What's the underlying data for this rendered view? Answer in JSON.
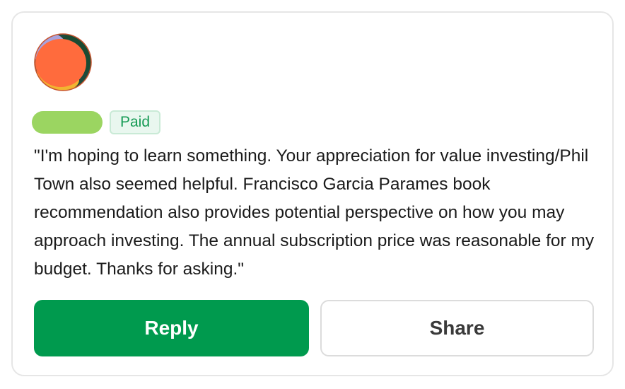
{
  "comment": {
    "badge": "Paid",
    "text": "\"I'm hoping to learn something. Your appreciation for value investing/Phil Town also seemed helpful. Francisco Garcia Parames book recommendation also provides potential perspective on how you may approach investing. The annual subscription price was reasonable for my budget. Thanks for asking.\"",
    "avatar_icon": "abstract-avatar-icon"
  },
  "actions": {
    "reply_label": "Reply",
    "share_label": "Share"
  },
  "colors": {
    "accent": "#009a4e",
    "badge_text": "#169b55",
    "badge_bg": "#e9f7ef",
    "name_placeholder": "#9bd561"
  }
}
